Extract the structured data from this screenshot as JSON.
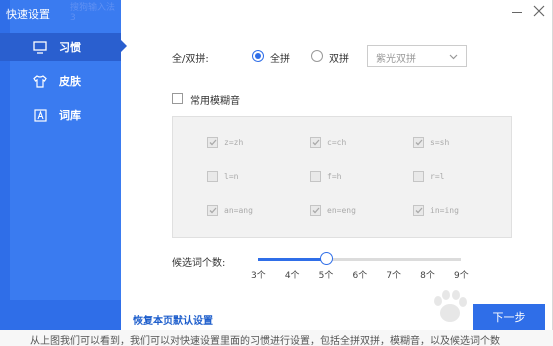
{
  "window": {
    "title": "快速设置",
    "title_ghost": "搜狗输入法 3"
  },
  "sidebar": {
    "items": [
      {
        "label": "习惯",
        "icon": "monitor-icon",
        "active": true
      },
      {
        "label": "皮肤",
        "icon": "tshirt-icon",
        "active": false
      },
      {
        "label": "词库",
        "icon": "lexicon-a-icon",
        "active": false
      }
    ]
  },
  "pinyin_mode": {
    "label": "全/双拼:",
    "options": [
      {
        "label": "全拼",
        "selected": true
      },
      {
        "label": "双拼",
        "selected": false
      }
    ],
    "scheme_select": {
      "value": "紫光双拼"
    }
  },
  "fuzzy": {
    "label": "常用模糊音",
    "checked": false,
    "pairs": [
      {
        "text": "z=zh",
        "checked": true
      },
      {
        "text": "c=ch",
        "checked": true
      },
      {
        "text": "s=sh",
        "checked": true
      },
      {
        "text": "l=n",
        "checked": false
      },
      {
        "text": "f=h",
        "checked": false
      },
      {
        "text": "r=l",
        "checked": false
      },
      {
        "text": "an=ang",
        "checked": true
      },
      {
        "text": "en=eng",
        "checked": true
      },
      {
        "text": "in=ing",
        "checked": true
      }
    ]
  },
  "candidates": {
    "label": "候选词个数:",
    "ticks": [
      "3个",
      "4个",
      "5个",
      "6个",
      "7个",
      "8个",
      "9个"
    ],
    "selected": "5个"
  },
  "footer": {
    "restore_label": "恢复本页默认设置",
    "next_label": "下一步"
  },
  "underlying_page_text": "从上图我们可以看到，我们可以对快速设置里面的习惯进行设置，包括全拼双拼，模糊音，以及候选词个数",
  "colors": {
    "accent": "#2f6ee8",
    "sidebar": "#2f6ee8",
    "active_item": "#2a5fcf"
  }
}
